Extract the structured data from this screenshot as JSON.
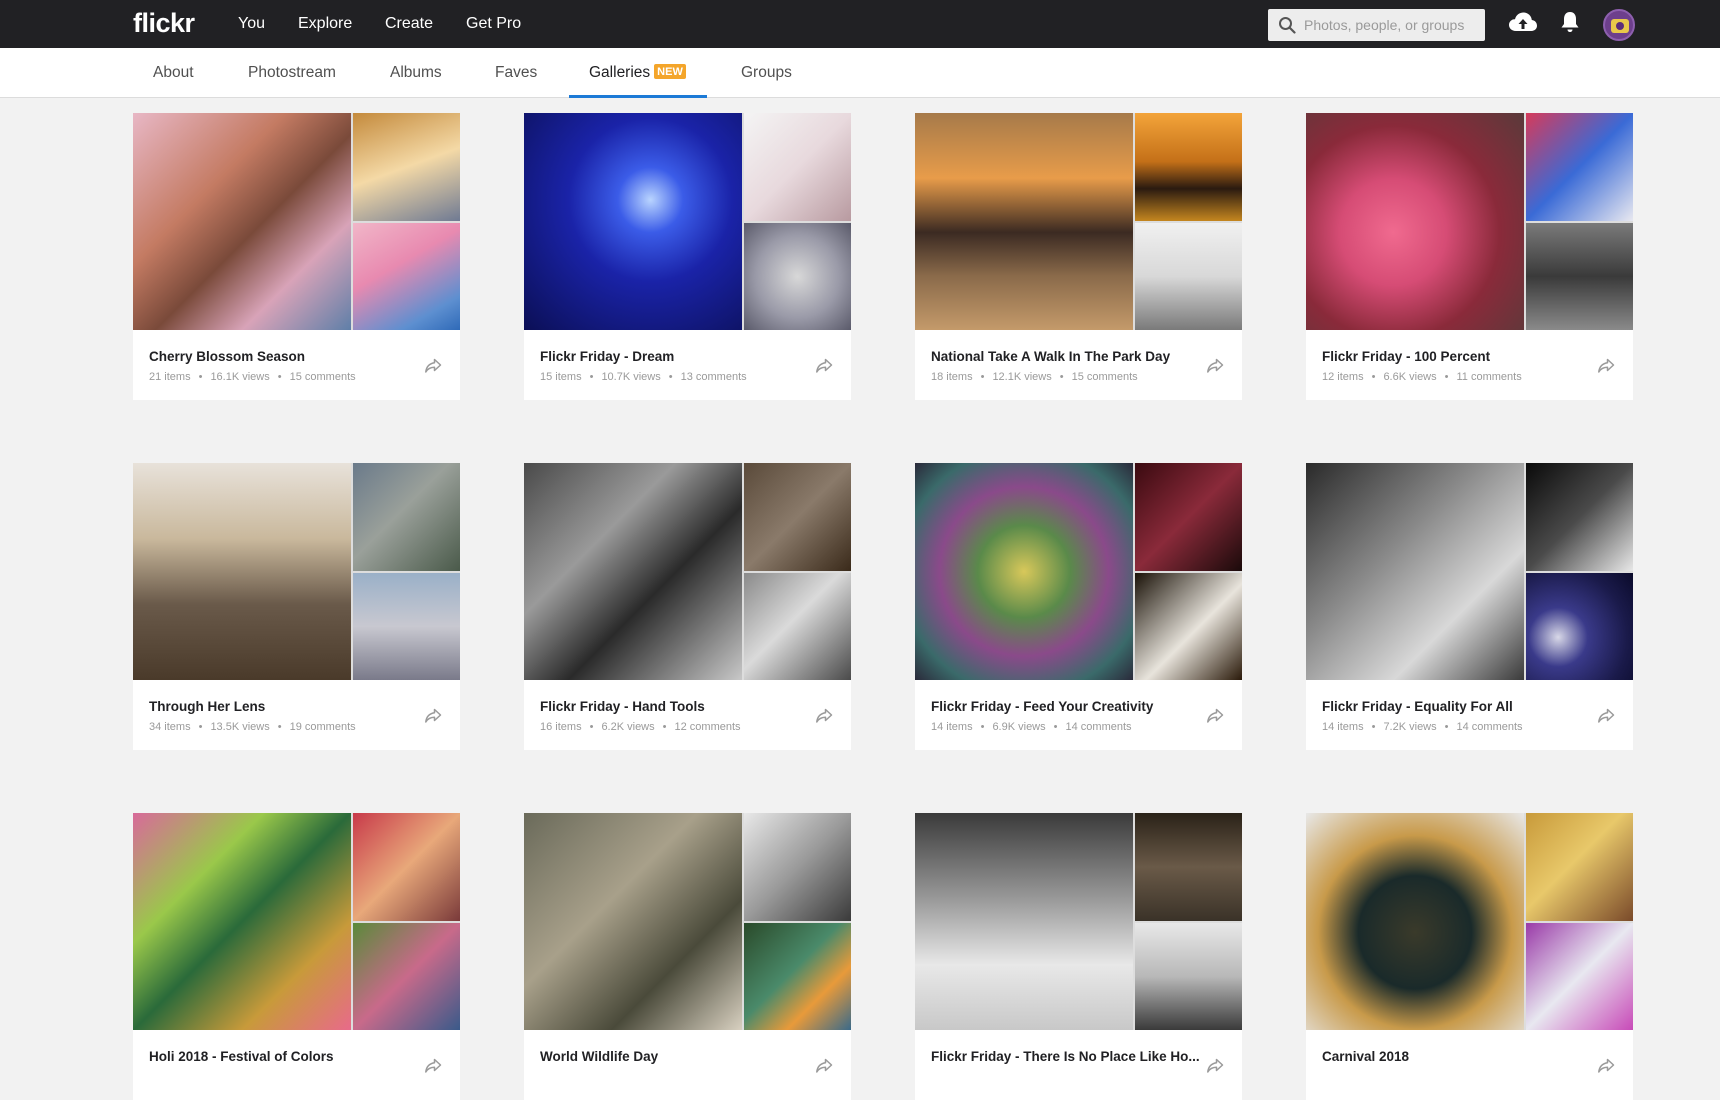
{
  "header": {
    "logo": "flickr",
    "nav": [
      "You",
      "Explore",
      "Create",
      "Get Pro"
    ],
    "search_placeholder": "Photos, people, or groups"
  },
  "subnav": {
    "tabs": [
      "About",
      "Photostream",
      "Albums",
      "Faves",
      "Galleries",
      "Groups"
    ],
    "active": "Galleries",
    "badge": "NEW"
  },
  "galleries": [
    {
      "title": "Cherry Blossom Season",
      "items": "21 items",
      "views": "16.1K views",
      "comments": "15 comments"
    },
    {
      "title": "Flickr Friday - Dream",
      "items": "15 items",
      "views": "10.7K views",
      "comments": "13 comments"
    },
    {
      "title": "National Take A Walk In The Park Day",
      "items": "18 items",
      "views": "12.1K views",
      "comments": "15 comments"
    },
    {
      "title": "Flickr Friday - 100 Percent",
      "items": "12 items",
      "views": "6.6K views",
      "comments": "11 comments"
    },
    {
      "title": "Through Her Lens",
      "items": "34 items",
      "views": "13.5K views",
      "comments": "19 comments"
    },
    {
      "title": "Flickr Friday - Hand Tools",
      "items": "16 items",
      "views": "6.2K views",
      "comments": "12 comments"
    },
    {
      "title": "Flickr Friday - Feed Your Creativity",
      "items": "14 items",
      "views": "6.9K views",
      "comments": "14 comments"
    },
    {
      "title": "Flickr Friday - Equality For All",
      "items": "14 items",
      "views": "7.2K views",
      "comments": "14 comments"
    },
    {
      "title": "Holi 2018 - Festival of Colors",
      "items": "",
      "views": "",
      "comments": ""
    },
    {
      "title": "World Wildlife Day",
      "items": "",
      "views": "",
      "comments": ""
    },
    {
      "title": "Flickr Friday - There Is No Place Like Ho...",
      "items": "",
      "views": "",
      "comments": ""
    },
    {
      "title": "Carnival 2018",
      "items": "",
      "views": "",
      "comments": ""
    }
  ],
  "icons": {
    "search": "magnifier-icon",
    "upload": "cloud-upload-icon",
    "notifications": "bell-icon",
    "share": "share-arrow-icon"
  },
  "colors": {
    "topbar": "#212124",
    "accent": "#1c7ad6",
    "badge": "#f4a52a"
  }
}
